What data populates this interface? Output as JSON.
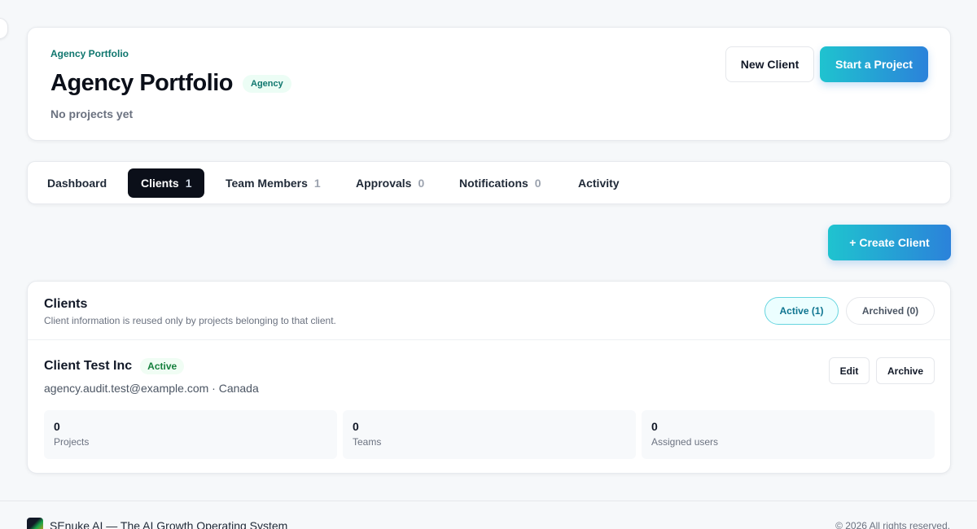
{
  "header": {
    "eyebrow": "Agency Portfolio",
    "title": "Agency Portfolio",
    "type_badge": "Agency",
    "subtitle": "No projects yet",
    "new_client_label": "New Client",
    "start_project_label": "Start a Project"
  },
  "tabs": [
    {
      "label": "Dashboard",
      "count": ""
    },
    {
      "label": "Clients",
      "count": "1",
      "active": true
    },
    {
      "label": "Team Members",
      "count": "1"
    },
    {
      "label": "Approvals",
      "count": "0"
    },
    {
      "label": "Notifications",
      "count": "0"
    },
    {
      "label": "Activity",
      "count": ""
    }
  ],
  "actions": {
    "create_client_label": "+ Create Client"
  },
  "clients_section": {
    "title": "Clients",
    "description": "Client information is reused only by projects belonging to that client.",
    "filters": {
      "active_label": "Active (1)",
      "archived_label": "Archived (0)"
    },
    "client": {
      "name": "Client Test Inc",
      "status": "Active",
      "meta": "agency.audit.test@example.com · Canada",
      "edit_label": "Edit",
      "archive_label": "Archive",
      "stats": [
        {
          "value": "0",
          "label": "Projects"
        },
        {
          "value": "0",
          "label": "Teams"
        },
        {
          "value": "0",
          "label": "Assigned users"
        }
      ]
    }
  },
  "footer": {
    "brand_text": "SEnuke AI — The AI Growth Operating System",
    "copyright": "© 2026 All rights reserved."
  },
  "colors": {
    "accent_start": "#1fc3cf",
    "accent_end": "#2b82da",
    "active_tab": "#0b0f19",
    "badge_teal": "#0f766e",
    "status_green": "#15803d"
  }
}
